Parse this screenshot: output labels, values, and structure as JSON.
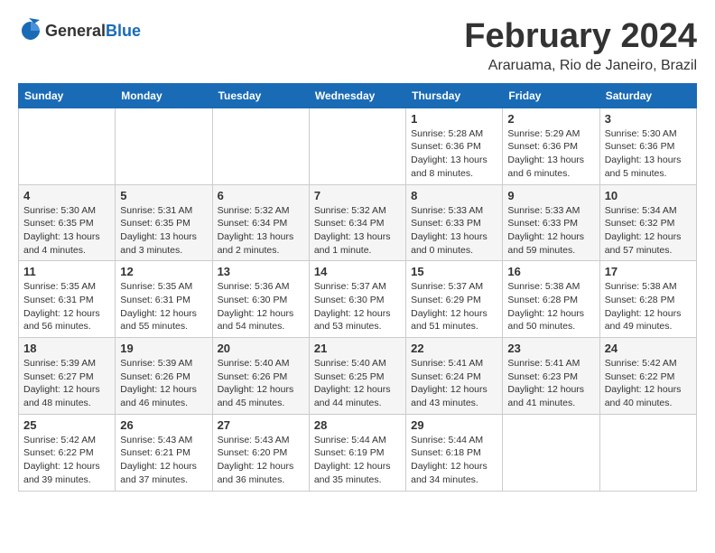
{
  "header": {
    "logo_general": "General",
    "logo_blue": "Blue",
    "title": "February 2024",
    "location": "Araruama, Rio de Janeiro, Brazil"
  },
  "days_of_week": [
    "Sunday",
    "Monday",
    "Tuesday",
    "Wednesday",
    "Thursday",
    "Friday",
    "Saturday"
  ],
  "weeks": [
    [
      {
        "day": "",
        "info": ""
      },
      {
        "day": "",
        "info": ""
      },
      {
        "day": "",
        "info": ""
      },
      {
        "day": "",
        "info": ""
      },
      {
        "day": "1",
        "info": "Sunrise: 5:28 AM\nSunset: 6:36 PM\nDaylight: 13 hours\nand 8 minutes."
      },
      {
        "day": "2",
        "info": "Sunrise: 5:29 AM\nSunset: 6:36 PM\nDaylight: 13 hours\nand 6 minutes."
      },
      {
        "day": "3",
        "info": "Sunrise: 5:30 AM\nSunset: 6:36 PM\nDaylight: 13 hours\nand 5 minutes."
      }
    ],
    [
      {
        "day": "4",
        "info": "Sunrise: 5:30 AM\nSunset: 6:35 PM\nDaylight: 13 hours\nand 4 minutes."
      },
      {
        "day": "5",
        "info": "Sunrise: 5:31 AM\nSunset: 6:35 PM\nDaylight: 13 hours\nand 3 minutes."
      },
      {
        "day": "6",
        "info": "Sunrise: 5:32 AM\nSunset: 6:34 PM\nDaylight: 13 hours\nand 2 minutes."
      },
      {
        "day": "7",
        "info": "Sunrise: 5:32 AM\nSunset: 6:34 PM\nDaylight: 13 hours\nand 1 minute."
      },
      {
        "day": "8",
        "info": "Sunrise: 5:33 AM\nSunset: 6:33 PM\nDaylight: 13 hours\nand 0 minutes."
      },
      {
        "day": "9",
        "info": "Sunrise: 5:33 AM\nSunset: 6:33 PM\nDaylight: 12 hours\nand 59 minutes."
      },
      {
        "day": "10",
        "info": "Sunrise: 5:34 AM\nSunset: 6:32 PM\nDaylight: 12 hours\nand 57 minutes."
      }
    ],
    [
      {
        "day": "11",
        "info": "Sunrise: 5:35 AM\nSunset: 6:31 PM\nDaylight: 12 hours\nand 56 minutes."
      },
      {
        "day": "12",
        "info": "Sunrise: 5:35 AM\nSunset: 6:31 PM\nDaylight: 12 hours\nand 55 minutes."
      },
      {
        "day": "13",
        "info": "Sunrise: 5:36 AM\nSunset: 6:30 PM\nDaylight: 12 hours\nand 54 minutes."
      },
      {
        "day": "14",
        "info": "Sunrise: 5:37 AM\nSunset: 6:30 PM\nDaylight: 12 hours\nand 53 minutes."
      },
      {
        "day": "15",
        "info": "Sunrise: 5:37 AM\nSunset: 6:29 PM\nDaylight: 12 hours\nand 51 minutes."
      },
      {
        "day": "16",
        "info": "Sunrise: 5:38 AM\nSunset: 6:28 PM\nDaylight: 12 hours\nand 50 minutes."
      },
      {
        "day": "17",
        "info": "Sunrise: 5:38 AM\nSunset: 6:28 PM\nDaylight: 12 hours\nand 49 minutes."
      }
    ],
    [
      {
        "day": "18",
        "info": "Sunrise: 5:39 AM\nSunset: 6:27 PM\nDaylight: 12 hours\nand 48 minutes."
      },
      {
        "day": "19",
        "info": "Sunrise: 5:39 AM\nSunset: 6:26 PM\nDaylight: 12 hours\nand 46 minutes."
      },
      {
        "day": "20",
        "info": "Sunrise: 5:40 AM\nSunset: 6:26 PM\nDaylight: 12 hours\nand 45 minutes."
      },
      {
        "day": "21",
        "info": "Sunrise: 5:40 AM\nSunset: 6:25 PM\nDaylight: 12 hours\nand 44 minutes."
      },
      {
        "day": "22",
        "info": "Sunrise: 5:41 AM\nSunset: 6:24 PM\nDaylight: 12 hours\nand 43 minutes."
      },
      {
        "day": "23",
        "info": "Sunrise: 5:41 AM\nSunset: 6:23 PM\nDaylight: 12 hours\nand 41 minutes."
      },
      {
        "day": "24",
        "info": "Sunrise: 5:42 AM\nSunset: 6:22 PM\nDaylight: 12 hours\nand 40 minutes."
      }
    ],
    [
      {
        "day": "25",
        "info": "Sunrise: 5:42 AM\nSunset: 6:22 PM\nDaylight: 12 hours\nand 39 minutes."
      },
      {
        "day": "26",
        "info": "Sunrise: 5:43 AM\nSunset: 6:21 PM\nDaylight: 12 hours\nand 37 minutes."
      },
      {
        "day": "27",
        "info": "Sunrise: 5:43 AM\nSunset: 6:20 PM\nDaylight: 12 hours\nand 36 minutes."
      },
      {
        "day": "28",
        "info": "Sunrise: 5:44 AM\nSunset: 6:19 PM\nDaylight: 12 hours\nand 35 minutes."
      },
      {
        "day": "29",
        "info": "Sunrise: 5:44 AM\nSunset: 6:18 PM\nDaylight: 12 hours\nand 34 minutes."
      },
      {
        "day": "",
        "info": ""
      },
      {
        "day": "",
        "info": ""
      }
    ]
  ]
}
